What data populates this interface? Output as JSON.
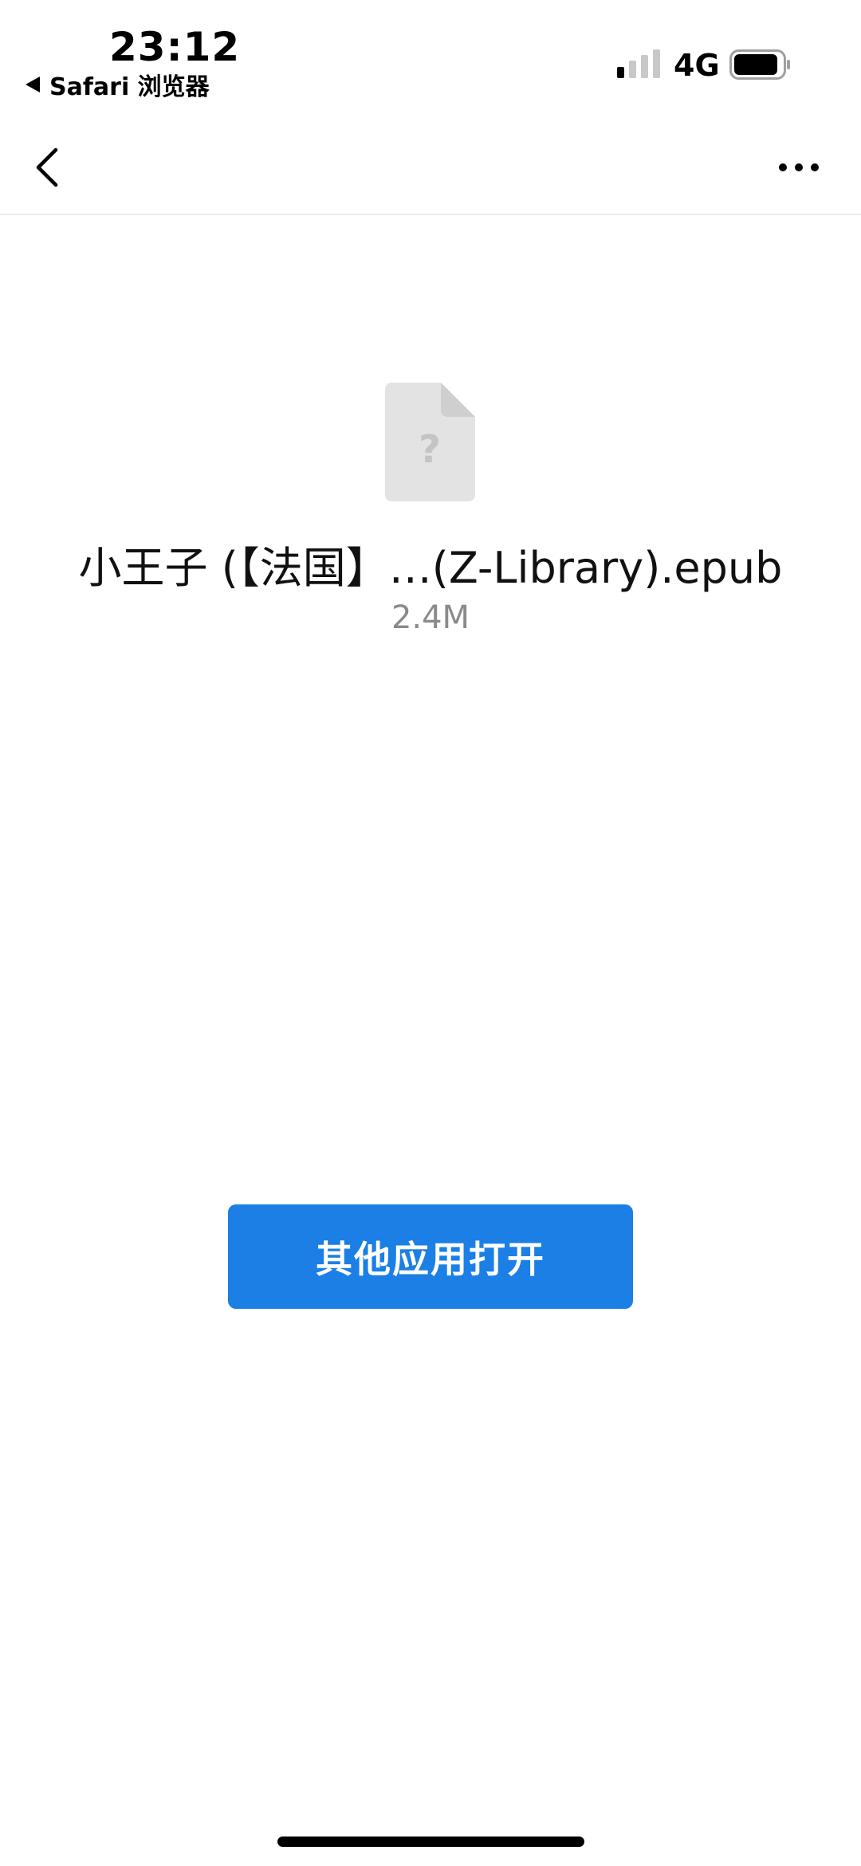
{
  "status_bar": {
    "time": "23:12",
    "back_app_label": "Safari 浏览器",
    "network": "4G",
    "signal_icon": "cellular-signal-icon",
    "battery_icon": "battery-icon"
  },
  "nav": {
    "back_icon": "chevron-left-icon",
    "more_icon": "more-dots-icon"
  },
  "file": {
    "icon": "unknown-file-icon",
    "name": "小王子 (【法国】…(Z-Library).epub",
    "size": "2.4M"
  },
  "actions": {
    "open_with_other_app_label": "其他应用打开"
  },
  "colors": {
    "primary": "#1b7fe5",
    "secondary_text": "#8a8a8a",
    "file_icon": "#e3e3e3"
  }
}
